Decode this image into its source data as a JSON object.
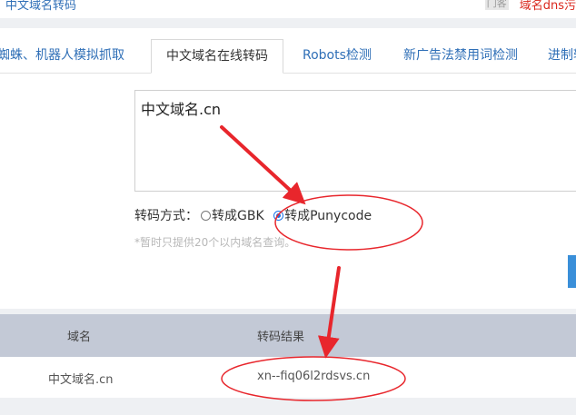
{
  "topbar": {
    "crumb": "中文域名转码",
    "right_box": "门客",
    "right_text": "域名dns污"
  },
  "tabs": [
    {
      "label": "蜘蛛、机器人模拟抓取"
    },
    {
      "label": "中文域名在线转码"
    },
    {
      "label": "Robots检测"
    },
    {
      "label": "新广告法禁用词检测"
    },
    {
      "label": "进制转"
    }
  ],
  "input": {
    "value": "中文域名.cn"
  },
  "options": {
    "label": "转码方式：",
    "choices": [
      "转成GBK",
      "转成Punycode"
    ],
    "selected": "转成Punycode"
  },
  "hint": "*暂时只提供20个以内域名查询。",
  "table": {
    "headers": [
      "域名",
      "转码结果"
    ],
    "rows": [
      {
        "domain": "中文域名.cn",
        "result": "xn--fiq06l2rdsvs.cn"
      }
    ]
  },
  "colors": {
    "accent": "#2f6fb7",
    "annotation": "#e8262c",
    "table_header_bg": "#c3c9d6"
  }
}
